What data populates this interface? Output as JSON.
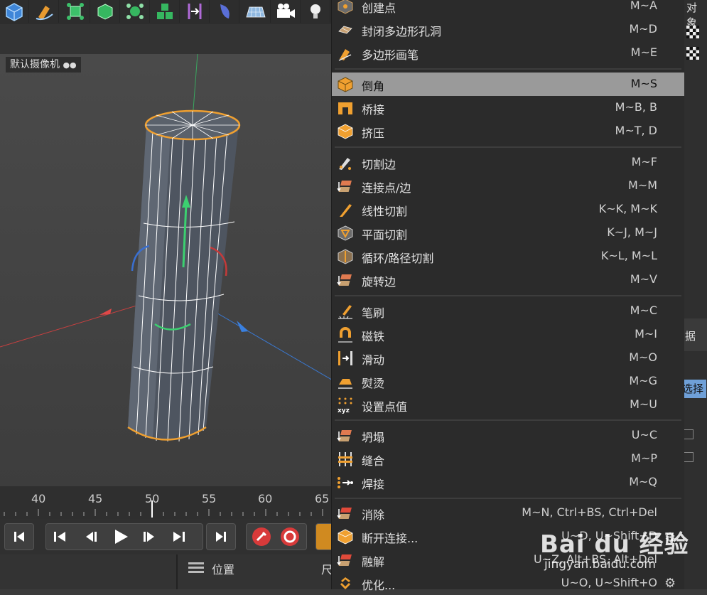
{
  "viewport": {
    "camera_label": "默认摄像机",
    "timeline_ticks": [
      "40",
      "45",
      "50",
      "55",
      "60",
      "65"
    ]
  },
  "bottom_panel": {
    "position_label": "位置",
    "clipped_label": "尺"
  },
  "right_panel": {
    "top_label": "对象",
    "mid_label": "据",
    "select_label": "选择"
  },
  "menu": {
    "items": [
      {
        "label": "创建点",
        "shortcut": "M~A",
        "icon": "create-point-icon"
      },
      {
        "label": "封闭多边形孔洞",
        "shortcut": "M~D",
        "icon": "close-polygon-hole-icon"
      },
      {
        "label": "多边形画笔",
        "shortcut": "M~E",
        "icon": "polygon-pen-icon"
      },
      {
        "label": "倒角",
        "shortcut": "M~S",
        "icon": "bevel-icon"
      },
      {
        "label": "桥接",
        "shortcut": "M~B, B",
        "icon": "bridge-icon"
      },
      {
        "label": "挤压",
        "shortcut": "M~T, D",
        "icon": "extrude-icon"
      },
      {
        "label": "切割边",
        "shortcut": "M~F",
        "icon": "cut-edges-icon"
      },
      {
        "label": "连接点/边",
        "shortcut": "M~M",
        "icon": "connect-points-edges-icon"
      },
      {
        "label": "线性切割",
        "shortcut": "K~K, M~K",
        "icon": "line-cut-icon"
      },
      {
        "label": "平面切割",
        "shortcut": "K~J, M~J",
        "icon": "plane-cut-icon"
      },
      {
        "label": "循环/路径切割",
        "shortcut": "K~L, M~L",
        "icon": "loop-path-cut-icon"
      },
      {
        "label": "旋转边",
        "shortcut": "M~V",
        "icon": "spin-edge-icon"
      },
      {
        "label": "笔刷",
        "shortcut": "M~C",
        "icon": "brush-icon"
      },
      {
        "label": "磁铁",
        "shortcut": "M~I",
        "icon": "magnet-icon"
      },
      {
        "label": "滑动",
        "shortcut": "M~O",
        "icon": "slide-icon"
      },
      {
        "label": "熨烫",
        "shortcut": "M~G",
        "icon": "iron-icon"
      },
      {
        "label": "设置点值",
        "shortcut": "M~U",
        "icon": "set-point-value-icon"
      },
      {
        "label": "坍塌",
        "shortcut": "U~C",
        "icon": "collapse-icon"
      },
      {
        "label": "缝合",
        "shortcut": "M~P",
        "icon": "stitch-icon"
      },
      {
        "label": "焊接",
        "shortcut": "M~Q",
        "icon": "weld-icon"
      },
      {
        "label": "消除",
        "shortcut": "M~N, Ctrl+BS, Ctrl+Del",
        "icon": "dissolve-icon"
      },
      {
        "label": "断开连接...",
        "shortcut": "U~D, U~Shift+D",
        "icon": "disconnect-icon"
      },
      {
        "label": "融解",
        "shortcut": "U~Z, Alt+BS, Alt+Del",
        "icon": "melt-icon"
      },
      {
        "label": "优化...",
        "shortcut": "U~O, U~Shift+O",
        "icon": "optimize-icon"
      }
    ]
  },
  "watermark": {
    "brand": "Bai du 经验",
    "url": "jingyan.baidu.com"
  },
  "colors": {
    "menu_bg": "#2b2b2b",
    "highlight": "#9a9a9a",
    "accent_orange": "#f0a030",
    "viewport_bg": "#454545"
  }
}
